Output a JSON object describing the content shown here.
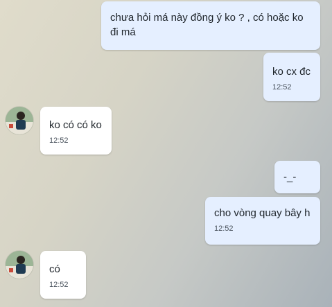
{
  "messages": [
    {
      "direction": "out",
      "text": "chưa hỏi má này đồng ý ko ? , có hoặc ko đi má",
      "time": ""
    },
    {
      "direction": "out",
      "text": "ko cx đc",
      "time": "12:52"
    },
    {
      "direction": "in",
      "text": "ko có có ko",
      "time": "12:52"
    },
    {
      "direction": "out",
      "text": "-_-",
      "time": ""
    },
    {
      "direction": "out",
      "text": "cho vòng quay bây h",
      "time": "12:52"
    },
    {
      "direction": "in",
      "text": "có",
      "time": "12:52"
    }
  ],
  "colors": {
    "outgoing_bubble": "#e5efff",
    "incoming_bubble": "#ffffff",
    "timestamp": "#49525c"
  },
  "icons": {
    "contact_avatar": "avatar-photo"
  }
}
